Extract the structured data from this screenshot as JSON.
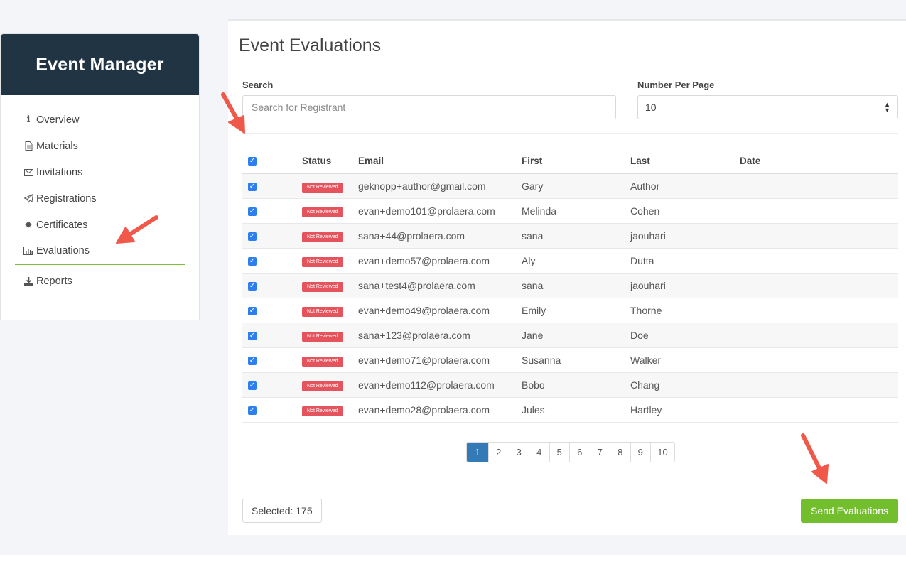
{
  "sidebar": {
    "title": "Event Manager",
    "items": [
      {
        "icon": "info-icon",
        "label": "Overview"
      },
      {
        "icon": "file-icon",
        "label": "Materials"
      },
      {
        "icon": "envelope-icon",
        "label": "Invitations"
      },
      {
        "icon": "paper-plane-icon",
        "label": "Registrations"
      },
      {
        "icon": "certificate-icon",
        "label": "Certificates"
      },
      {
        "icon": "bar-chart-icon",
        "label": "Evaluations"
      },
      {
        "icon": "download-icon",
        "label": "Reports"
      }
    ],
    "active_item": "Evaluations"
  },
  "main": {
    "title": "Event Evaluations",
    "search": {
      "label": "Search",
      "placeholder": "Search for Registrant",
      "value": ""
    },
    "per_page": {
      "label": "Number Per Page",
      "value": "10"
    },
    "table": {
      "columns": [
        "Status",
        "Email",
        "First",
        "Last",
        "Date"
      ],
      "rows": [
        {
          "status": "Not Reviewed",
          "email": "geknopp+author@gmail.com",
          "first": "Gary",
          "last": "Author",
          "date": ""
        },
        {
          "status": "Not Reviewed",
          "email": "evan+demo101@prolaera.com",
          "first": "Melinda",
          "last": "Cohen",
          "date": ""
        },
        {
          "status": "Not Reviewed",
          "email": "sana+44@prolaera.com",
          "first": "sana",
          "last": "jaouhari",
          "date": ""
        },
        {
          "status": "Not Reviewed",
          "email": "evan+demo57@prolaera.com",
          "first": "Aly",
          "last": "Dutta",
          "date": ""
        },
        {
          "status": "Not Reviewed",
          "email": "sana+test4@prolaera.com",
          "first": "sana",
          "last": "jaouhari",
          "date": ""
        },
        {
          "status": "Not Reviewed",
          "email": "evan+demo49@prolaera.com",
          "first": "Emily",
          "last": "Thorne",
          "date": ""
        },
        {
          "status": "Not Reviewed",
          "email": "sana+123@prolaera.com",
          "first": "Jane",
          "last": "Doe",
          "date": ""
        },
        {
          "status": "Not Reviewed",
          "email": "evan+demo71@prolaera.com",
          "first": "Susanna",
          "last": "Walker",
          "date": ""
        },
        {
          "status": "Not Reviewed",
          "email": "evan+demo112@prolaera.com",
          "first": "Bobo",
          "last": "Chang",
          "date": ""
        },
        {
          "status": "Not Reviewed",
          "email": "evan+demo28@prolaera.com",
          "first": "Jules",
          "last": "Hartley",
          "date": ""
        }
      ]
    },
    "pagination": {
      "pages": [
        "1",
        "2",
        "3",
        "4",
        "5",
        "6",
        "7",
        "8",
        "9",
        "10"
      ],
      "current": "1"
    },
    "selected_text": "Selected: 175",
    "send_button": "Send Evaluations"
  },
  "colors": {
    "sidebar_header": "#213444",
    "active_underline": "#7cbf3a",
    "badge": "#e5535c",
    "send_button": "#73be2d",
    "page_active": "#337ab7",
    "annotation_arrow": "#f0584a"
  }
}
